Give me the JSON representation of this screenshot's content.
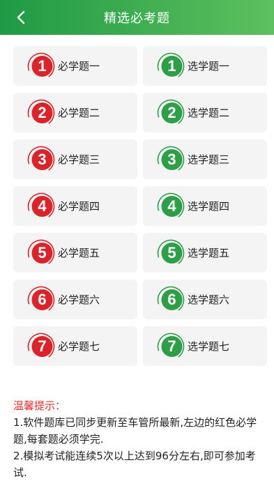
{
  "header": {
    "title": "精选必考题"
  },
  "colors": {
    "required": "#d8242a",
    "optional": "#2e9e48"
  },
  "required": [
    {
      "num": "1",
      "label": "必学题一"
    },
    {
      "num": "2",
      "label": "必学题二"
    },
    {
      "num": "3",
      "label": "必学题三"
    },
    {
      "num": "4",
      "label": "必学题四"
    },
    {
      "num": "5",
      "label": "必学题五"
    },
    {
      "num": "6",
      "label": "必学题六"
    },
    {
      "num": "7",
      "label": "必学题七"
    }
  ],
  "optional": [
    {
      "num": "1",
      "label": "选学题一"
    },
    {
      "num": "2",
      "label": "选学题二"
    },
    {
      "num": "3",
      "label": "选学题三"
    },
    {
      "num": "4",
      "label": "选学题四"
    },
    {
      "num": "5",
      "label": "选学题五"
    },
    {
      "num": "6",
      "label": "选学题六"
    },
    {
      "num": "7",
      "label": "选学题七"
    }
  ],
  "tips": {
    "title": "温馨提示：",
    "lines": [
      "1.软件题库已同步更新至车管所最新,左边的红色必学题,每套题必须学完.",
      "2.模拟考试能连续5次以上达到96分左右,即可参加考试."
    ]
  }
}
